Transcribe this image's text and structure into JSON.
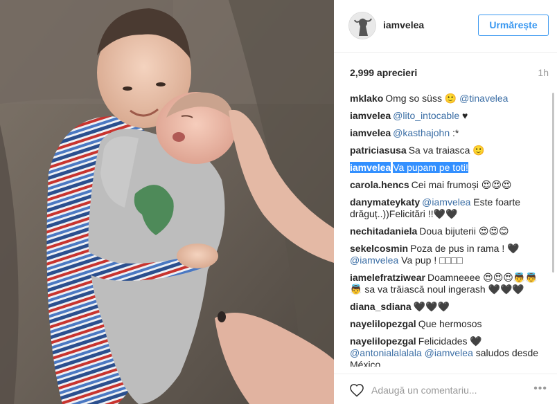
{
  "post": {
    "username": "iamvelea",
    "follow_label": "Urmărește",
    "likes": "2,999 aprecieri",
    "time_ago": "1h"
  },
  "comments": [
    {
      "user": "mklako",
      "parts": [
        {
          "t": "text",
          "v": "Omg so süss 🙂 "
        },
        {
          "t": "mention",
          "v": "@tinavelea"
        }
      ]
    },
    {
      "user": "iamvelea",
      "parts": [
        {
          "t": "mention",
          "v": "@lito_intocable"
        },
        {
          "t": "text",
          "v": " ♥"
        }
      ]
    },
    {
      "user": "iamvelea",
      "parts": [
        {
          "t": "mention",
          "v": "@kasthajohn"
        },
        {
          "t": "text",
          "v": " :*"
        }
      ]
    },
    {
      "user": "patriciasusa",
      "parts": [
        {
          "t": "text",
          "v": "Sa va traiasca 🙂"
        }
      ]
    },
    {
      "user": "iamvelea",
      "highlight": true,
      "parts": [
        {
          "t": "text",
          "v": "Va pupam pe toti!"
        }
      ]
    },
    {
      "user": "carola.hencs",
      "parts": [
        {
          "t": "text",
          "v": "Cei mai frumoși 😍😍😍"
        }
      ]
    },
    {
      "user": "danymateykaty",
      "parts": [
        {
          "t": "mention",
          "v": "@iamvelea"
        },
        {
          "t": "text",
          "v": " Este foarte drăguț..))Felicitări !!🖤🖤"
        }
      ]
    },
    {
      "user": "nechitadaniela",
      "parts": [
        {
          "t": "text",
          "v": "Doua bijuterii 😍😍😊"
        }
      ]
    },
    {
      "user": "sekelcosmin",
      "parts": [
        {
          "t": "text",
          "v": "Poza de pus in rama ! 🖤 "
        },
        {
          "t": "mention",
          "v": "@iamvelea"
        },
        {
          "t": "text",
          "v": " Va pup ! □□□□"
        }
      ]
    },
    {
      "user": "iamelefratziwear",
      "parts": [
        {
          "t": "text",
          "v": "Doamneeee 😍😍😍👼👼👼 sa va trăiască noul ingerash 🖤🖤🖤"
        }
      ]
    },
    {
      "user": "diana_sdiana",
      "parts": [
        {
          "t": "text",
          "v": "🖤🖤🖤"
        }
      ]
    },
    {
      "user": "nayelilopezgal",
      "parts": [
        {
          "t": "text",
          "v": "Que hermosos"
        }
      ]
    },
    {
      "user": "nayelilopezgal",
      "parts": [
        {
          "t": "text",
          "v": "Felicidades 🖤 "
        },
        {
          "t": "mention",
          "v": "@antonialalalala"
        },
        {
          "t": "text",
          "v": " "
        },
        {
          "t": "mention",
          "v": "@iamvelea"
        },
        {
          "t": "text",
          "v": " saludos desde México"
        }
      ]
    }
  ],
  "footer": {
    "comment_placeholder": "Adaugă un comentariu...",
    "more_label": "•••"
  },
  "icons": {
    "like": "heart-icon",
    "more": "more-options-icon",
    "avatar": "avatar"
  },
  "colors": {
    "follow_blue": "#3897f0",
    "mention": "#3b6ea5",
    "selection": "#3390ff"
  }
}
